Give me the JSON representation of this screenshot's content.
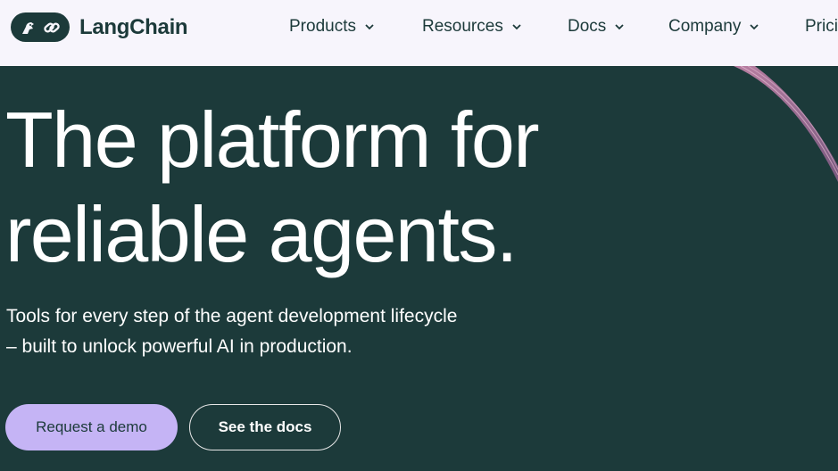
{
  "brand": {
    "name": "LangChain"
  },
  "nav": {
    "items": [
      {
        "label": "Products",
        "has_dropdown": true
      },
      {
        "label": "Resources",
        "has_dropdown": true
      },
      {
        "label": "Docs",
        "has_dropdown": true
      },
      {
        "label": "Company",
        "has_dropdown": true
      },
      {
        "label": "Prici",
        "has_dropdown": false
      }
    ]
  },
  "hero": {
    "title_line1": "The platform for",
    "title_line2": "reliable agents.",
    "subtitle_line1": "Tools for every step of the agent development lifecycle",
    "subtitle_line2": "– built to unlock powerful AI in production."
  },
  "buttons": {
    "primary": "Request a demo",
    "secondary": "See the docs"
  },
  "icons": {
    "logo": "parrot-link-icon",
    "dropdown": "chevron-down-icon"
  },
  "colors": {
    "nav_bg": "#f7f5fc",
    "hero_bg": "#1c3a3a",
    "primary_button": "#c5b4f5",
    "accent_arc": "#c07fa8"
  }
}
